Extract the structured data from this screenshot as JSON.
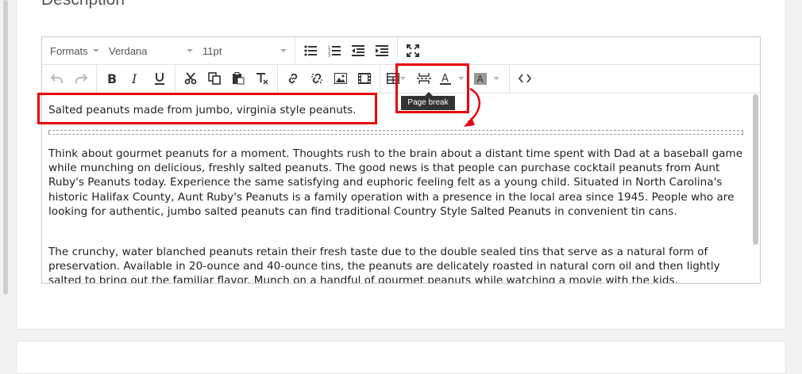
{
  "section": {
    "title": "Description"
  },
  "toolbar": {
    "formats_label": "Formats",
    "font_family": "Verdana",
    "font_size": "11pt",
    "row1_buttons": [
      "bullet-list-icon",
      "numbered-list-icon",
      "outdent-icon",
      "indent-icon",
      "fullscreen-icon"
    ],
    "row2_buttons": [
      "undo-icon",
      "redo-icon",
      "bold-icon",
      "italic-icon",
      "underline-icon",
      "cut-icon",
      "copy-icon",
      "paste-icon",
      "clear-format-icon",
      "link-icon",
      "unlink-icon",
      "image-icon",
      "media-icon",
      "table-icon",
      "page-break-icon",
      "text-color-icon",
      "background-color-icon",
      "source-code-icon"
    ]
  },
  "tooltip": {
    "text": "Page break"
  },
  "content": {
    "paragraph1": "Salted peanuts made from jumbo, virginia style peanuts.",
    "paragraph2": "Think about gourmet peanuts for a moment. Thoughts rush to the brain about a distant time spent with Dad at a baseball game while munching on delicious, freshly salted peanuts. The good news is that people can purchase cocktail peanuts from Aunt Ruby's Peanuts today. Experience the same satisfying and euphoric feeling felt as a young child. Situated in North Carolina's historic Halifax County, Aunt Ruby's Peanuts is a family operation with a presence in the local area since 1945. People who are looking for authentic, jumbo salted peanuts can find traditional Country Style Salted Peanuts in convenient tin cans.",
    "paragraph3": "The crunchy, water blanched peanuts retain their fresh taste due to the double sealed tins that serve as a natural form of preservation. Available in 20-ounce and 40-ounce tins, the peanuts are delicately roasted in natural corn oil and then lightly salted to bring out the familiar flavor. Munch on a handful of gourmet peanuts while watching a movie with the kids."
  },
  "colors": {
    "highlight": "#e8000b",
    "tooltip_bg": "#333333"
  }
}
